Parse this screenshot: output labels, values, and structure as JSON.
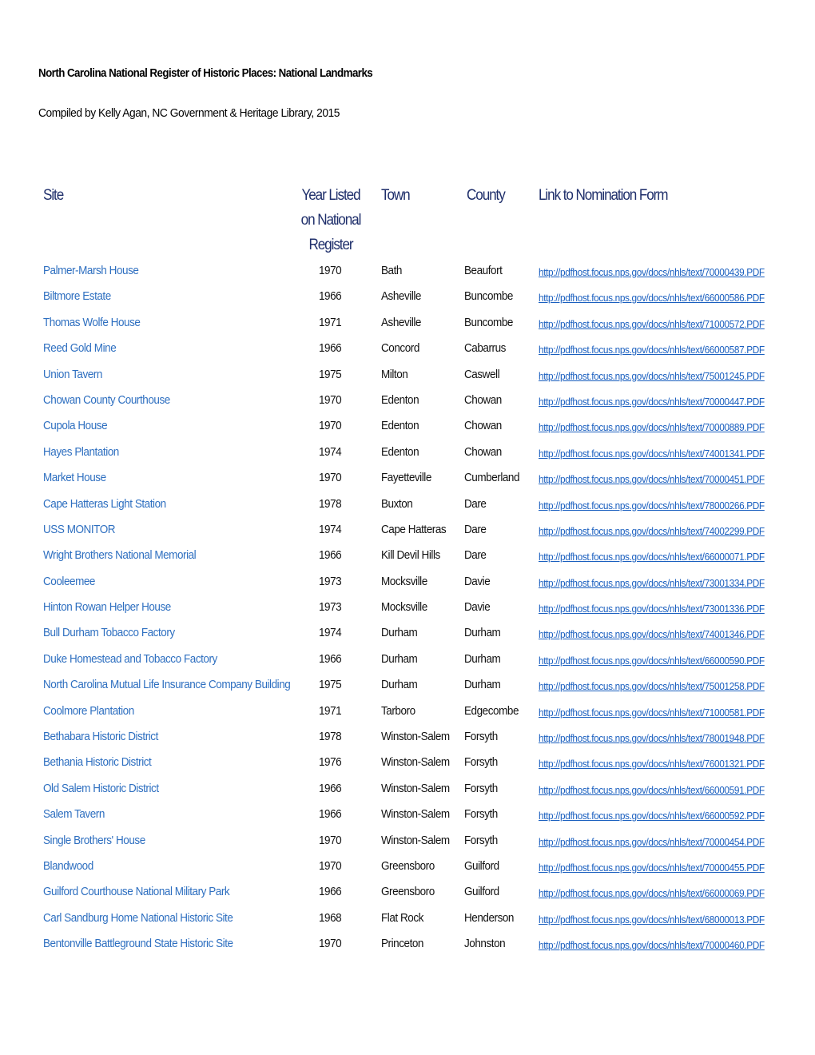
{
  "document": {
    "title": "North Carolina National Register of Historic Places: National Landmarks",
    "subtitle": "Compiled by Kelly Agan, NC Government & Heritage Library, 2015"
  },
  "table": {
    "headers": {
      "site": "Site",
      "year": "Year Listed on National Register",
      "town": "Town",
      "county": "County",
      "link": "Link to Nomination Form"
    },
    "link_color": "#2e6fc0",
    "header_color": "#1f2f6b",
    "rows": [
      {
        "site": "Palmer-Marsh House",
        "year": "1970",
        "town": "Bath",
        "county": "Beaufort",
        "link": "http://pdfhost.focus.nps.gov/docs/nhls/text/70000439.PDF"
      },
      {
        "site": "Biltmore Estate",
        "year": "1966",
        "town": "Asheville",
        "county": "Buncombe",
        "link": "http://pdfhost.focus.nps.gov/docs/nhls/text/66000586.PDF"
      },
      {
        "site": "Thomas Wolfe House",
        "year": "1971",
        "town": "Asheville",
        "county": "Buncombe",
        "link": "http://pdfhost.focus.nps.gov/docs/nhls/text/71000572.PDF"
      },
      {
        "site": "Reed Gold Mine",
        "year": "1966",
        "town": "Concord",
        "county": "Cabarrus",
        "link": "http://pdfhost.focus.nps.gov/docs/nhls/text/66000587.PDF"
      },
      {
        "site": "Union Tavern",
        "year": "1975",
        "town": "Milton",
        "county": "Caswell",
        "link": "http://pdfhost.focus.nps.gov/docs/nhls/text/75001245.PDF"
      },
      {
        "site": "Chowan County Courthouse",
        "year": "1970",
        "town": "Edenton",
        "county": "Chowan",
        "link": "http://pdfhost.focus.nps.gov/docs/nhls/text/70000447.PDF"
      },
      {
        "site": "Cupola House",
        "year": "1970",
        "town": "Edenton",
        "county": "Chowan",
        "link": "http://pdfhost.focus.nps.gov/docs/nhls/text/70000889.PDF"
      },
      {
        "site": "Hayes Plantation",
        "year": "1974",
        "town": "Edenton",
        "county": "Chowan",
        "link": "http://pdfhost.focus.nps.gov/docs/nhls/text/74001341.PDF"
      },
      {
        "site": "Market House",
        "year": "1970",
        "town": "Fayetteville",
        "county": "Cumberland",
        "link": "http://pdfhost.focus.nps.gov/docs/nhls/text/70000451.PDF"
      },
      {
        "site": "Cape Hatteras Light Station",
        "year": "1978",
        "town": "Buxton",
        "county": "Dare",
        "link": "http://pdfhost.focus.nps.gov/docs/nhls/text/78000266.PDF"
      },
      {
        "site": "USS MONITOR",
        "year": "1974",
        "town": "Cape Hatteras",
        "county": "Dare",
        "link": "http://pdfhost.focus.nps.gov/docs/nhls/text/74002299.PDF"
      },
      {
        "site": "Wright Brothers National Memorial",
        "year": "1966",
        "town": "Kill Devil Hills",
        "county": "Dare",
        "link": "http://pdfhost.focus.nps.gov/docs/nhls/text/66000071.PDF"
      },
      {
        "site": "Cooleemee",
        "year": "1973",
        "town": "Mocksville",
        "county": "Davie",
        "link": "http://pdfhost.focus.nps.gov/docs/nhls/text/73001334.PDF"
      },
      {
        "site": "Hinton Rowan Helper House",
        "year": "1973",
        "town": "Mocksville",
        "county": "Davie",
        "link": "http://pdfhost.focus.nps.gov/docs/nhls/text/73001336.PDF"
      },
      {
        "site": "Bull Durham Tobacco Factory",
        "year": "1974",
        "town": "Durham",
        "county": "Durham",
        "link": "http://pdfhost.focus.nps.gov/docs/nhls/text/74001346.PDF"
      },
      {
        "site": "Duke Homestead and Tobacco Factory",
        "year": "1966",
        "town": "Durham",
        "county": "Durham",
        "link": "http://pdfhost.focus.nps.gov/docs/nhls/text/66000590.PDF"
      },
      {
        "site": "North Carolina Mutual Life Insurance Company Building",
        "year": "1975",
        "town": "Durham",
        "county": "Durham",
        "link": "http://pdfhost.focus.nps.gov/docs/nhls/text/75001258.PDF"
      },
      {
        "site": "Coolmore Plantation",
        "year": "1971",
        "town": "Tarboro",
        "county": "Edgecombe",
        "link": "http://pdfhost.focus.nps.gov/docs/nhls/text/71000581.PDF"
      },
      {
        "site": "Bethabara Historic District",
        "year": "1978",
        "town": "Winston-Salem",
        "county": "Forsyth",
        "link": "http://pdfhost.focus.nps.gov/docs/nhls/text/78001948.PDF"
      },
      {
        "site": "Bethania Historic District",
        "year": "1976",
        "town": "Winston-Salem",
        "county": "Forsyth",
        "link": "http://pdfhost.focus.nps.gov/docs/nhls/text/76001321.PDF"
      },
      {
        "site": "Old Salem Historic District",
        "year": "1966",
        "town": "Winston-Salem",
        "county": "Forsyth",
        "link": "http://pdfhost.focus.nps.gov/docs/nhls/text/66000591.PDF"
      },
      {
        "site": "Salem Tavern",
        "year": "1966",
        "town": "Winston-Salem",
        "county": "Forsyth",
        "link": "http://pdfhost.focus.nps.gov/docs/nhls/text/66000592.PDF"
      },
      {
        "site": "Single Brothers' House",
        "year": "1970",
        "town": "Winston-Salem",
        "county": "Forsyth",
        "link": "http://pdfhost.focus.nps.gov/docs/nhls/text/70000454.PDF"
      },
      {
        "site": "Blandwood",
        "year": "1970",
        "town": "Greensboro",
        "county": "Guilford",
        "link": "http://pdfhost.focus.nps.gov/docs/nhls/text/70000455.PDF"
      },
      {
        "site": "Guilford Courthouse National Military Park",
        "year": "1966",
        "town": "Greensboro",
        "county": "Guilford",
        "link": "http://pdfhost.focus.nps.gov/docs/nhls/text/66000069.PDF"
      },
      {
        "site": "Carl Sandburg Home National Historic Site",
        "year": "1968",
        "town": "Flat Rock",
        "county": "Henderson",
        "link": "http://pdfhost.focus.nps.gov/docs/nhls/text/68000013.PDF"
      },
      {
        "site": "Bentonville Battleground State Historic Site",
        "year": "1970",
        "town": "Princeton",
        "county": "Johnston",
        "link": "http://pdfhost.focus.nps.gov/docs/nhls/text/70000460.PDF"
      }
    ]
  }
}
